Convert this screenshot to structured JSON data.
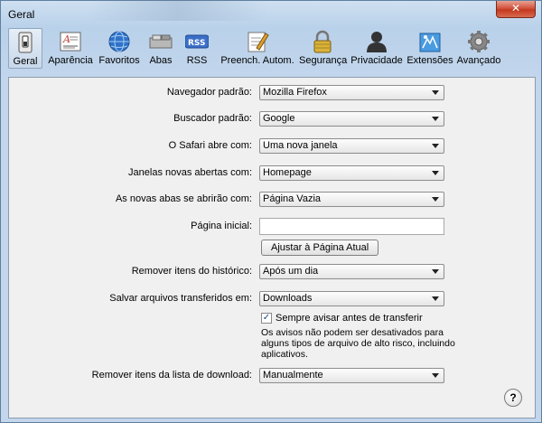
{
  "window": {
    "title": "Geral",
    "close_glyph": "✕"
  },
  "toolbar": {
    "items": [
      {
        "label": "Geral",
        "icon": "switch-icon"
      },
      {
        "label": "Aparência",
        "icon": "font-icon"
      },
      {
        "label": "Favoritos",
        "icon": "globe-icon"
      },
      {
        "label": "Abas",
        "icon": "tabs-icon"
      },
      {
        "label": "RSS",
        "icon": "rss-icon",
        "icon_text": "RSS"
      },
      {
        "label": "Preench. Autom.",
        "icon": "pencil-icon"
      },
      {
        "label": "Segurança",
        "icon": "lock-icon"
      },
      {
        "label": "Privacidade",
        "icon": "person-icon"
      },
      {
        "label": "Extensões",
        "icon": "puzzle-icon"
      },
      {
        "label": "Avançado",
        "icon": "gear-icon"
      }
    ]
  },
  "form": {
    "navegador": {
      "label": "Navegador padrão:",
      "value": "Mozilla Firefox"
    },
    "buscador": {
      "label": "Buscador padrão:",
      "value": "Google"
    },
    "abre_com": {
      "label": "O Safari abre com:",
      "value": "Uma nova janela"
    },
    "janelas_novas": {
      "label": "Janelas novas abertas com:",
      "value": "Homepage"
    },
    "novas_abas": {
      "label": "As novas abas se abrirão com:",
      "value": "Página Vazia"
    },
    "pagina_inicial": {
      "label": "Página inicial:",
      "value": ""
    },
    "ajustar_button": "Ajustar à Página Atual",
    "historico": {
      "label": "Remover itens do histórico:",
      "value": "Após um dia"
    },
    "salvar": {
      "label": "Salvar arquivos transferidos em:",
      "value": "Downloads"
    },
    "avisar": {
      "label": "Sempre avisar antes de transferir",
      "checked": true,
      "check_glyph": "✓"
    },
    "aviso_nota": "Os avisos não podem ser desativados para alguns tipos de arquivo de alto risco, incluindo aplicativos.",
    "lista_download": {
      "label": "Remover itens da lista de download:",
      "value": "Manualmente"
    }
  },
  "help": {
    "glyph": "?"
  },
  "colors": {
    "accent": "#1d5fa8",
    "content_bg": "#f0f0f0",
    "close": "#c4381f"
  }
}
